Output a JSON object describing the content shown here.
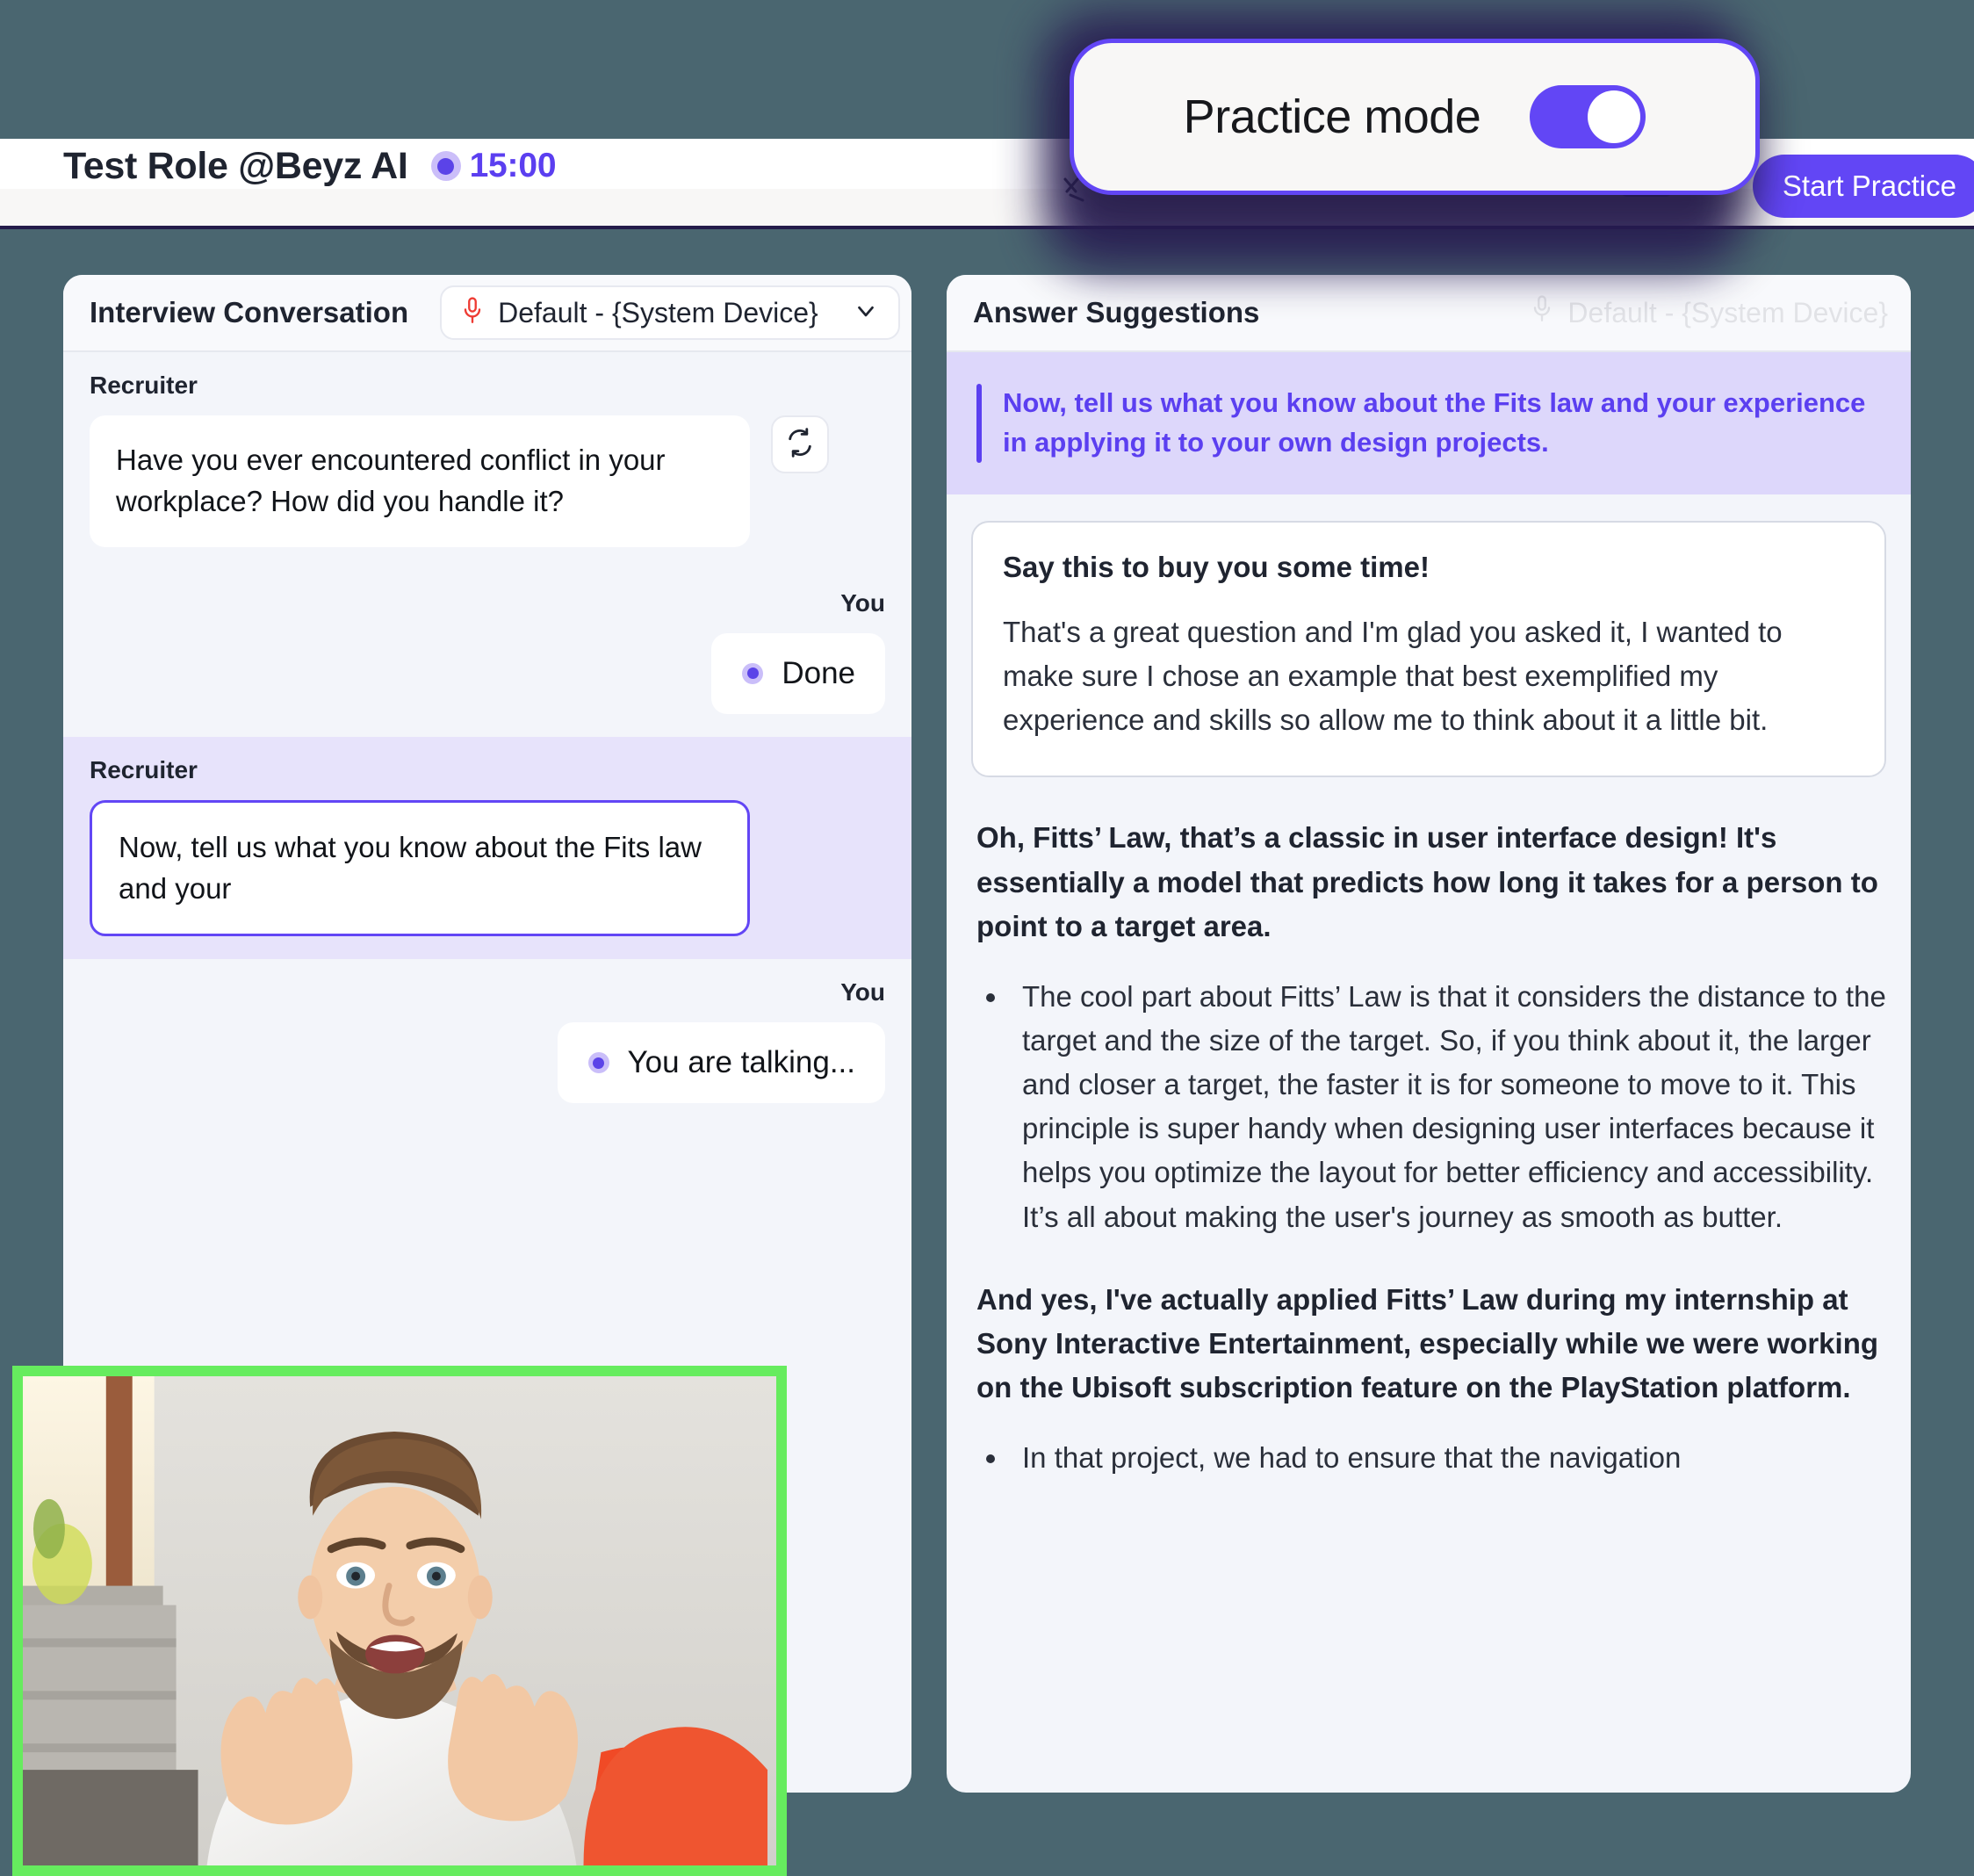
{
  "header": {
    "title": "Test Role @Beyz AI",
    "timer": "15:00",
    "recording_dot": "recording-dot",
    "start_practice_label": "Start Practice"
  },
  "practice_overlay": {
    "label": "Practice mode",
    "toggle_state": "on",
    "accent_color": "#6246f5",
    "glow_color": "#2a1f55"
  },
  "conversation_panel": {
    "title": "Interview Conversation",
    "device_select": {
      "icon": "microphone-icon",
      "value": "Default - {System Device}",
      "chevron": "chevron-down-icon"
    },
    "messages": [
      {
        "speaker": "Recruiter",
        "side": "left",
        "text": "Have you ever encountered conflict in your workplace? How did you handle it?",
        "highlight": false,
        "active": false,
        "has_refresh": true
      },
      {
        "speaker": "You",
        "side": "right",
        "text": "Done",
        "status": true,
        "active": false
      },
      {
        "speaker": "Recruiter",
        "side": "left",
        "text": "Now, tell us what you know about the Fits law and your",
        "highlight": true,
        "active": true,
        "has_refresh": false
      },
      {
        "speaker": "You",
        "side": "right",
        "text": "You are talking...",
        "status": true,
        "active": false
      }
    ]
  },
  "suggestions_panel": {
    "title": "Answer Suggestions",
    "ghost_device_text": "Default - {System Device}",
    "question": "Now, tell us what you know about the Fits law and your experience in applying it to your own design projects.",
    "buy_time": {
      "title": "Say this to buy you some time!",
      "text": "That's a great question and I'm glad you asked it, I wanted to make sure I chose an example that best exemplified my experience and skills so allow me to think about it a little bit."
    },
    "answer": {
      "paragraph_1": "Oh, Fitts’ Law, that’s a classic in user interface design! It's essentially a model that predicts how long it takes for a person to point to a target area.",
      "bullet_1": "The cool part about Fitts’ Law is that it considers the distance to the target and the size of the target. So, if you think about it, the larger and closer a target, the faster it is for someone to move to it. This principle is super handy when designing user interfaces because it helps you optimize the layout for better efficiency and accessibility. It’s all about making the user's journey as smooth as butter.",
      "paragraph_2": "And yes, I've actually applied Fitts’ Law during my internship at Sony Interactive Entertainment, especially while we were working on the Ubisoft subscription feature on the PlayStation platform.",
      "bullet_2": "In that project, we had to ensure that the navigation"
    }
  },
  "video_thumbnail": {
    "border_color": "#66ec5e",
    "description": "self-view-video"
  },
  "colors": {
    "background": "#4a6670",
    "accent_purple": "#6246f5",
    "panel_bg": "#f3f5fa",
    "active_message_bg": "#e7e3fb",
    "question_banner_bg": "#ddd7fb",
    "question_text": "#5b3ff0",
    "mic_icon": "#ee3b33"
  }
}
